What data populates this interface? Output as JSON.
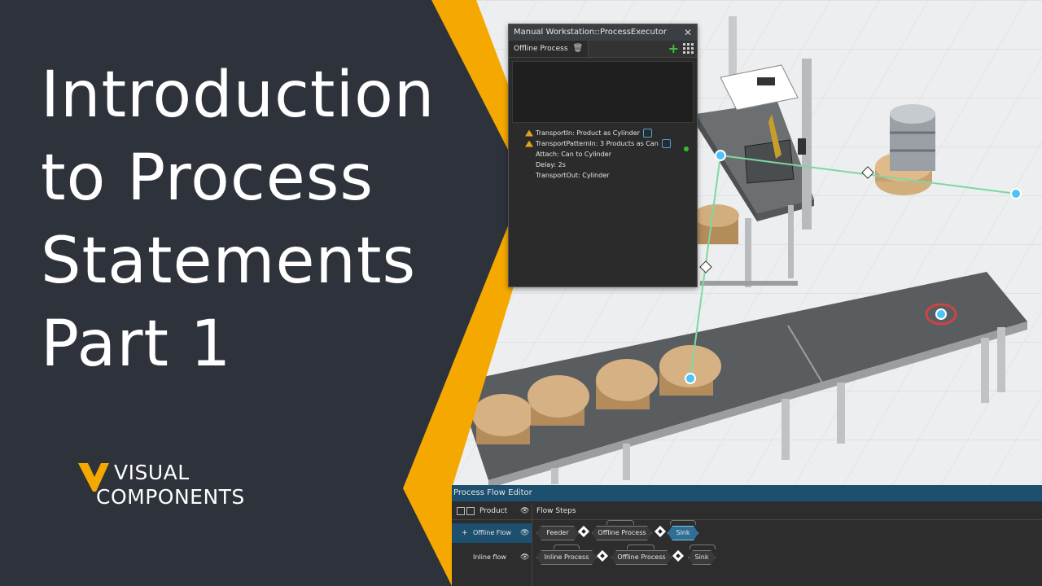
{
  "title": {
    "lines": [
      "Introduction",
      "to Process",
      "Statements",
      "Part 1"
    ]
  },
  "brand": {
    "line1": "VISUAL",
    "line2": "COMPONENTS",
    "logo_icon": "visual-components-chevron-logo",
    "accent": "#f5a800"
  },
  "colors": {
    "panel": "#2e323b",
    "accent": "#f5a800",
    "selection": "#1d4f6e",
    "connector": "#7fd8a0",
    "node": "#4fc3f7"
  },
  "executor": {
    "title": "Manual Workstation::ProcessExecutor",
    "close_icon": "close-icon",
    "tab": "Offline Process",
    "trash_icon": "trash-icon",
    "add_icon": "plus-icon",
    "grid_icon": "grid-icon",
    "statements": [
      "TransportIn: Product as Cylinder",
      "TransportPatternIn: 3 Products as Can",
      "Attach: Can to Cylinder",
      "Delay: 2s",
      "TransportOut: Cylinder"
    ]
  },
  "flow_editor": {
    "title": "Process Flow Editor",
    "header": {
      "product": "Product",
      "flow_steps": "Flow Steps"
    },
    "rows": [
      {
        "name": "Offline Flow",
        "steps": [
          "Feeder",
          "Offline Process",
          "Sink"
        ],
        "active_step": "Sink"
      },
      {
        "name": "Inline flow",
        "steps": [
          "Inline Process",
          "Offline Process",
          "Sink"
        ]
      }
    ]
  }
}
